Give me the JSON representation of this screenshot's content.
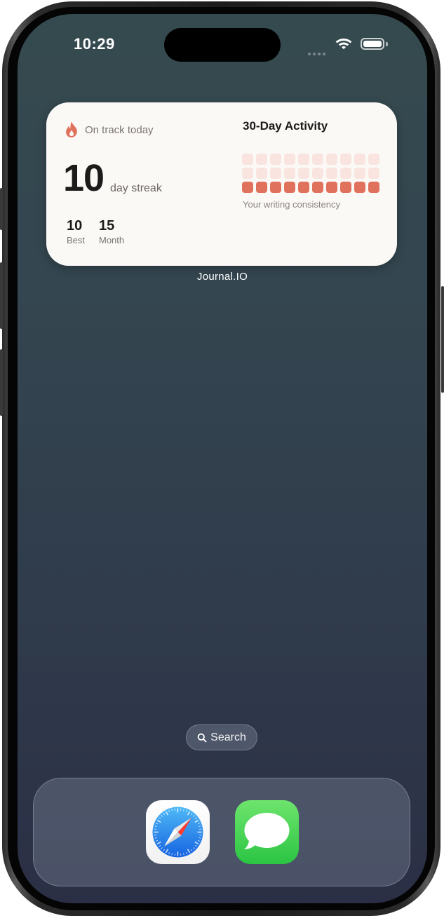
{
  "status_bar": {
    "time": "10:29"
  },
  "widget": {
    "status_text": "On track today",
    "streak_number": "10",
    "streak_label": "day streak",
    "stats": [
      {
        "value": "10",
        "label": "Best"
      },
      {
        "value": "15",
        "label": "Month"
      }
    ],
    "activity_title": "30-Day Activity",
    "activity_caption": "Your writing consistency",
    "activity_days": [
      0,
      0,
      0,
      0,
      0,
      0,
      0,
      0,
      0,
      0,
      0,
      0,
      0,
      0,
      0,
      0,
      0,
      0,
      0,
      0,
      1,
      1,
      1,
      1,
      1,
      1,
      1,
      1,
      1,
      1
    ],
    "colors": {
      "accent": "#e0715d",
      "inactive": "#f9e4df",
      "card": "#fbf9f6"
    }
  },
  "widget_name": "Journal.IO",
  "search": {
    "label": "Search"
  },
  "dock": {
    "apps": [
      {
        "name": "Safari",
        "icon": "safari-icon"
      },
      {
        "name": "Messages",
        "icon": "messages-icon"
      }
    ]
  }
}
